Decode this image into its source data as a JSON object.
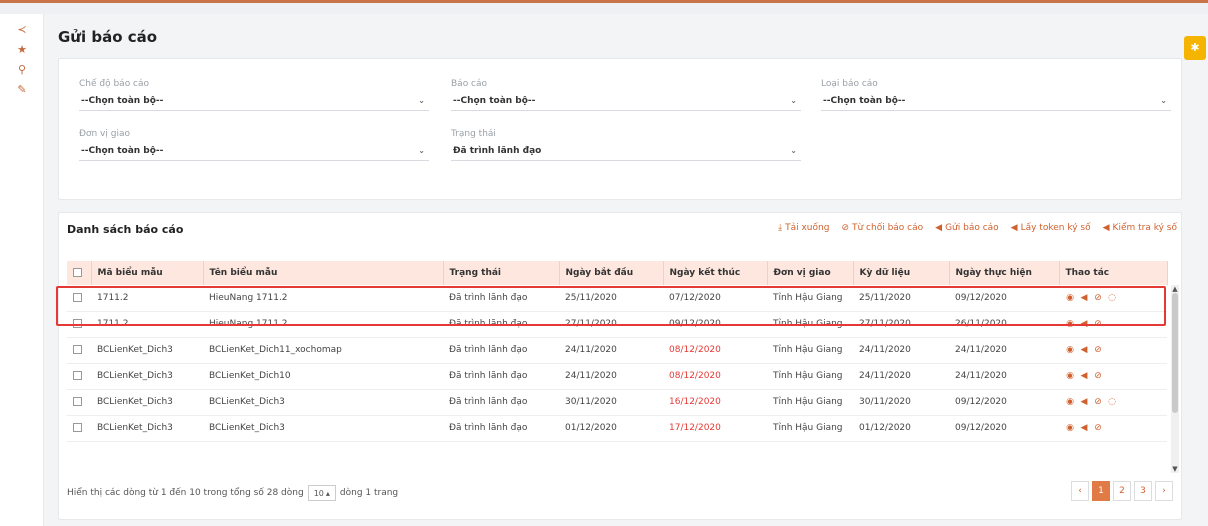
{
  "page": {
    "title": "Gửi báo cáo"
  },
  "rail": {
    "icons": [
      "share-icon",
      "star-icon",
      "search-icon",
      "pencil-icon"
    ]
  },
  "filters": {
    "che_do": {
      "label": "Chế độ báo cáo",
      "value": "--Chọn toàn bộ--"
    },
    "bao_cao": {
      "label": "Báo cáo",
      "value": "--Chọn toàn bộ--"
    },
    "loai": {
      "label": "Loại báo cáo",
      "value": "--Chọn toàn bộ--"
    },
    "don_vi": {
      "label": "Đơn vị giao",
      "value": "--Chọn toàn bộ--"
    },
    "trang_thai": {
      "label": "Trạng thái",
      "value": "Đã trình lãnh đạo"
    }
  },
  "list": {
    "title": "Danh sách báo cáo",
    "toolbar": [
      {
        "icon": "download-icon",
        "label": "Tải xuống"
      },
      {
        "icon": "reject-icon",
        "label": "Từ chối báo cáo"
      },
      {
        "icon": "send-icon",
        "label": "Gửi báo cáo"
      },
      {
        "icon": "send-icon",
        "label": "Lấy token ký số"
      },
      {
        "icon": "send-icon",
        "label": "Kiểm tra ký số"
      }
    ],
    "columns": [
      "Mã biểu mẫu",
      "Tên biểu mẫu",
      "Trạng thái",
      "Ngày bắt đầu",
      "Ngày kết thúc",
      "Đơn vị giao",
      "Kỳ dữ liệu",
      "Ngày thực hiện",
      "Thao tác"
    ],
    "rows": [
      {
        "ma": "1711.2",
        "ten": "HieuNang 1711.2",
        "trang_thai": "Đã trình lãnh đạo",
        "bat_dau": "25/11/2020",
        "ket_thuc": "07/12/2020",
        "ket_thuc_red": false,
        "don_vi": "Tỉnh Hậu Giang",
        "ky": "25/11/2020",
        "thuc_hien": "09/12/2020",
        "comment": true
      },
      {
        "ma": "1711.2",
        "ten": "HieuNang 1711.2",
        "trang_thai": "Đã trình lãnh đạo",
        "bat_dau": "27/11/2020",
        "ket_thuc": "09/12/2020",
        "ket_thuc_red": false,
        "don_vi": "Tỉnh Hậu Giang",
        "ky": "27/11/2020",
        "thuc_hien": "26/11/2020",
        "comment": false
      },
      {
        "ma": "BCLienKet_Dich3",
        "ten": "BCLienKet_Dich11_xochomap",
        "trang_thai": "Đã trình lãnh đạo",
        "bat_dau": "24/11/2020",
        "ket_thuc": "08/12/2020",
        "ket_thuc_red": true,
        "don_vi": "Tỉnh Hậu Giang",
        "ky": "24/11/2020",
        "thuc_hien": "24/11/2020",
        "comment": false
      },
      {
        "ma": "BCLienKet_Dich3",
        "ten": "BCLienKet_Dich10",
        "trang_thai": "Đã trình lãnh đạo",
        "bat_dau": "24/11/2020",
        "ket_thuc": "08/12/2020",
        "ket_thuc_red": true,
        "don_vi": "Tỉnh Hậu Giang",
        "ky": "24/11/2020",
        "thuc_hien": "24/11/2020",
        "comment": false
      },
      {
        "ma": "BCLienKet_Dich3",
        "ten": "BCLienKet_Dich3",
        "trang_thai": "Đã trình lãnh đạo",
        "bat_dau": "30/11/2020",
        "ket_thuc": "16/12/2020",
        "ket_thuc_red": true,
        "don_vi": "Tỉnh Hậu Giang",
        "ky": "30/11/2020",
        "thuc_hien": "09/12/2020",
        "comment": true
      },
      {
        "ma": "BCLienKet_Dich3",
        "ten": "BCLienKet_Dich3",
        "trang_thai": "Đã trình lãnh đạo",
        "bat_dau": "01/12/2020",
        "ket_thuc": "17/12/2020",
        "ket_thuc_red": true,
        "don_vi": "Tỉnh Hậu Giang",
        "ky": "01/12/2020",
        "thuc_hien": "09/12/2020",
        "comment": false
      }
    ]
  },
  "footer": {
    "info_before": "Hiển thị các dòng từ 1 đến 10 trong tổng số 28 dòng",
    "page_size": "10",
    "info_after": "dòng 1 trang",
    "pages": [
      "‹",
      "1",
      "2",
      "3",
      "›"
    ],
    "active_page": "1"
  },
  "colors": {
    "accent": "#d0612f",
    "header_bg": "#fde7df",
    "highlight": "#e53935",
    "fab": "#f4b400"
  }
}
